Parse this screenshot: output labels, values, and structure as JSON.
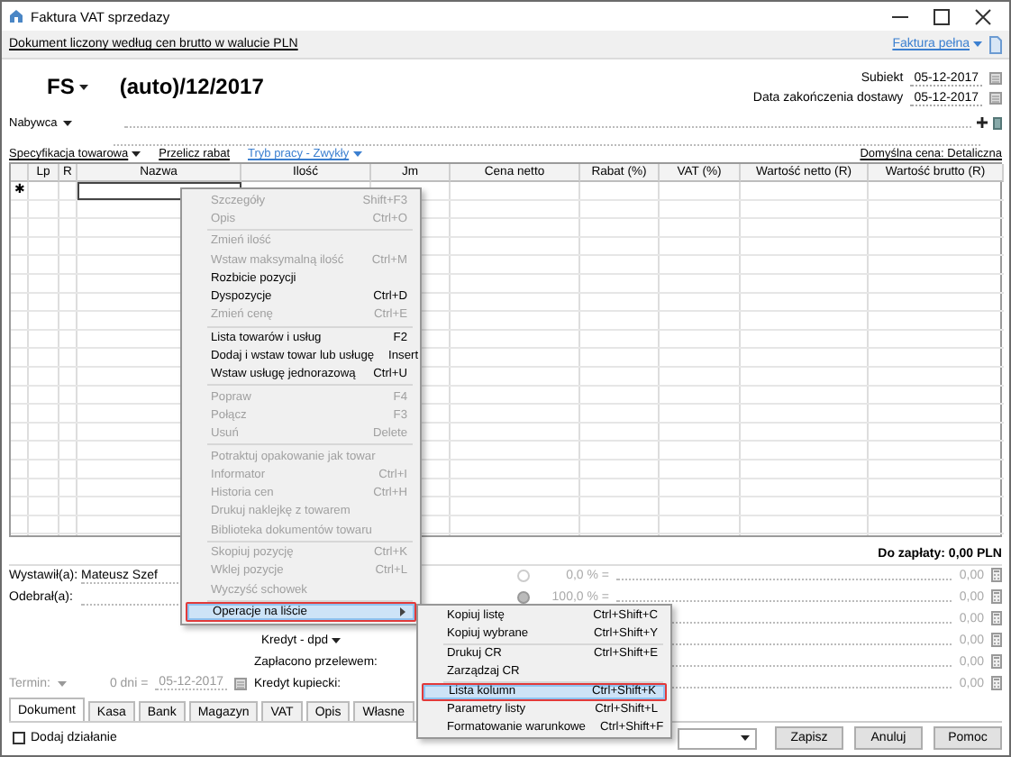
{
  "window": {
    "title": "Faktura VAT sprzedazy"
  },
  "info_bar": {
    "text": "Dokument liczony według cen brutto w walucie PLN",
    "mode_link": "Faktura pełna"
  },
  "document": {
    "type": "FS",
    "number": "(auto)/12/2017",
    "buyer_label": "Nabywca"
  },
  "dates": [
    {
      "label": "Subiekt",
      "value": "05-12-2017"
    },
    {
      "label": "Data zakończenia dostawy",
      "value": "05-12-2017"
    }
  ],
  "toolbar": {
    "items": [
      {
        "label": "Specyfikacja towarowa",
        "kind": "dropdown"
      },
      {
        "label": "Przelicz rabat",
        "kind": "link"
      },
      {
        "label": "Tryb pracy - Zwykły",
        "kind": "mode"
      }
    ],
    "default_price": "Domyślna cena: Detaliczna"
  },
  "table": {
    "columns": [
      "",
      "Lp",
      "R",
      "Nazwa",
      "Ilość",
      "Jm",
      "Cena netto",
      "Rabat (%)",
      "VAT (%)",
      "Wartość netto (R)",
      "Wartość brutto (R)"
    ],
    "new_row_marker": "✱"
  },
  "total": "Do zapłaty: 0,00 PLN",
  "people": [
    {
      "label": "Wystawił(a):",
      "value": "Mateusz Szef"
    },
    {
      "label": "Odebrał(a):"
    }
  ],
  "payment": {
    "method": "Kredyt - dpd",
    "lines": [
      "Zapłacono przelewem:",
      "Kredyt kupiecki:"
    ],
    "term_label": "Termin:",
    "term_days": "0 dni =",
    "term_date": "05-12-2017"
  },
  "amounts": [
    {
      "selected": false,
      "percent": "0,0 % =",
      "value": "0,00"
    },
    {
      "selected": true,
      "percent": "100,0 % =",
      "value": "0,00"
    },
    {
      "value": "0,00"
    },
    {
      "value": "0,00"
    },
    {
      "value": "0,00"
    },
    {
      "value": "0,00"
    }
  ],
  "tabs": [
    {
      "label": "Dokument",
      "selected": true
    },
    {
      "label": "Kasa",
      "selected": false
    },
    {
      "label": "Bank",
      "selected": false
    },
    {
      "label": "Magazyn",
      "selected": false
    },
    {
      "label": "VAT",
      "selected": false
    },
    {
      "label": "Opis",
      "selected": false
    },
    {
      "label": "Własne",
      "selected": false
    }
  ],
  "add_action": {
    "label": "Dodaj działanie",
    "checked": false
  },
  "buttons": [
    "Zapisz",
    "Anuluj",
    "Pomoc"
  ],
  "context_menu": {
    "items": [
      {
        "kind": "item",
        "label": "Szczegóły",
        "shortcut": "Shift+F3",
        "disabled": true,
        "selected": false
      },
      {
        "kind": "item",
        "label": "Opis",
        "shortcut": "Ctrl+O",
        "disabled": true,
        "selected": false
      },
      {
        "kind": "separator"
      },
      {
        "kind": "item",
        "label": "Zmień ilość",
        "disabled": true,
        "selected": false
      },
      {
        "kind": "item",
        "label": "Wstaw maksymalną ilość",
        "shortcut": "Ctrl+M",
        "disabled": true,
        "selected": false
      },
      {
        "kind": "item",
        "label": "Rozbicie pozycji",
        "disabled": false,
        "selected": false
      },
      {
        "kind": "item",
        "label": "Dyspozycje",
        "shortcut": "Ctrl+D",
        "disabled": false,
        "selected": false
      },
      {
        "kind": "item",
        "label": "Zmień cenę",
        "shortcut": "Ctrl+E",
        "disabled": true,
        "selected": false
      },
      {
        "kind": "separator"
      },
      {
        "kind": "item",
        "label": "Lista towarów i usług",
        "shortcut": "F2",
        "disabled": false,
        "selected": false
      },
      {
        "kind": "item",
        "label": "Dodaj i wstaw towar lub usługę",
        "shortcut": "Insert",
        "disabled": false,
        "selected": false
      },
      {
        "kind": "item",
        "label": "Wstaw usługę jednorazową",
        "shortcut": "Ctrl+U",
        "disabled": false,
        "selected": false
      },
      {
        "kind": "separator"
      },
      {
        "kind": "item",
        "label": "Popraw",
        "shortcut": "F4",
        "disabled": true,
        "selected": false
      },
      {
        "kind": "item",
        "label": "Połącz",
        "shortcut": "F3",
        "disabled": true,
        "selected": false
      },
      {
        "kind": "item",
        "label": "Usuń",
        "shortcut": "Delete",
        "disabled": true,
        "selected": false
      },
      {
        "kind": "separator"
      },
      {
        "kind": "item",
        "label": "Potraktuj opakowanie jak towar",
        "disabled": true,
        "selected": false
      },
      {
        "kind": "item",
        "label": "Informator",
        "shortcut": "Ctrl+I",
        "disabled": true,
        "selected": false
      },
      {
        "kind": "item",
        "label": "Historia cen",
        "shortcut": "Ctrl+H",
        "disabled": true,
        "selected": false
      },
      {
        "kind": "item",
        "label": "Drukuj naklejkę z towarem",
        "disabled": true,
        "selected": false
      },
      {
        "kind": "item",
        "label": "Biblioteka dokumentów towaru",
        "disabled": true,
        "selected": false
      },
      {
        "kind": "separator"
      },
      {
        "kind": "item",
        "label": "Skopiuj pozycję",
        "shortcut": "Ctrl+K",
        "disabled": true,
        "selected": false
      },
      {
        "kind": "item",
        "label": "Wklej pozycje",
        "shortcut": "Ctrl+L",
        "disabled": true,
        "selected": false
      },
      {
        "kind": "item",
        "label": "Wyczyść schowek",
        "disabled": true,
        "selected": false
      },
      {
        "kind": "separator"
      },
      {
        "kind": "submenu",
        "label": "Operacje na liście",
        "disabled": false,
        "selected": true
      }
    ]
  },
  "submenu": {
    "items": [
      {
        "kind": "item",
        "label": "Kopiuj listę",
        "shortcut": "Ctrl+Shift+C",
        "selected": false
      },
      {
        "kind": "item",
        "label": "Kopiuj wybrane",
        "shortcut": "Ctrl+Shift+Y",
        "selected": false
      },
      {
        "kind": "separator"
      },
      {
        "kind": "item",
        "label": "Drukuj CR",
        "shortcut": "Ctrl+Shift+E",
        "selected": false
      },
      {
        "kind": "item",
        "label": "Zarządzaj CR",
        "selected": false
      },
      {
        "kind": "separator"
      },
      {
        "kind": "item",
        "label": "Lista kolumn",
        "shortcut": "Ctrl+Shift+K",
        "selected": true
      },
      {
        "kind": "item",
        "label": "Parametry listy",
        "shortcut": "Ctrl+Shift+L",
        "selected": false
      },
      {
        "kind": "item",
        "label": "Formatowanie warunkowe",
        "shortcut": "Ctrl+Shift+F",
        "selected": false
      }
    ]
  }
}
